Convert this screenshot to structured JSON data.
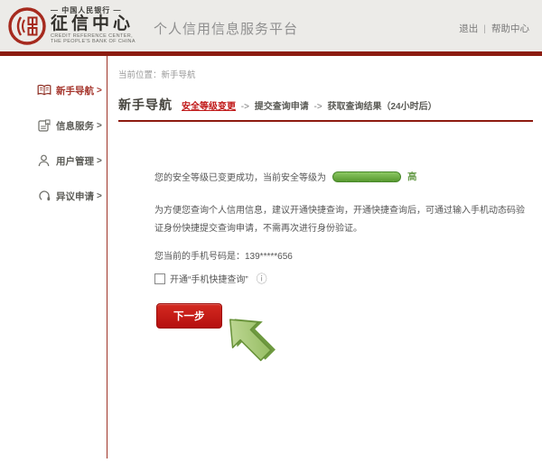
{
  "header": {
    "logo": {
      "bank_name": "— 中国人民银行 —",
      "brand": "征信中心",
      "english_line1": "CREDIT REFERENCE CENTER,",
      "english_line2": "THE PEOPLE'S BANK OF CHINA"
    },
    "platform_title": "个人信用信息服务平台",
    "links": {
      "logout": "退出",
      "divider": "|",
      "help": "帮助中心"
    }
  },
  "sidebar": {
    "items": [
      {
        "label": "新手导航",
        "arrow": ">",
        "icon": "open-book-icon",
        "active": true
      },
      {
        "label": "信息服务",
        "arrow": ">",
        "icon": "info-card-icon",
        "active": false
      },
      {
        "label": "用户管理",
        "arrow": ">",
        "icon": "user-icon",
        "active": false
      },
      {
        "label": "异议申请",
        "arrow": ">",
        "icon": "headset-icon",
        "active": false
      }
    ]
  },
  "main": {
    "breadcrumb": "当前位置：新手导航",
    "page_title": "新手导航",
    "steps": {
      "step1": "安全等级变更",
      "arrow1": "->",
      "step2": "提交查询申请",
      "arrow2": "->",
      "step3": "获取查询结果（24小时后）"
    },
    "status": {
      "prefix": "您的安全等级已变更成功，当前安全等级为",
      "level_label": "高"
    },
    "paragraph": "为方便您查询个人信用信息，建议开通快捷查询，开通快捷查询后，可通过输入手机动态码验证身份快捷提交查询申请，不需再次进行身份验证。",
    "phone_line": "您当前的手机号码是：139*****656",
    "quick_query": {
      "checkbox_label": "开通“手机快捷查询”",
      "info_icon": "ⓘ",
      "checked": false
    },
    "next_button": "下一步"
  },
  "colors": {
    "header_bg": "#ECEBE8",
    "brand_red": "#8C1C10",
    "button_red": "#C41414",
    "active_item_red": "#A5352C",
    "level_green": "#57992F",
    "arrow_green": "#A3C878",
    "text_gray": "#555555"
  }
}
